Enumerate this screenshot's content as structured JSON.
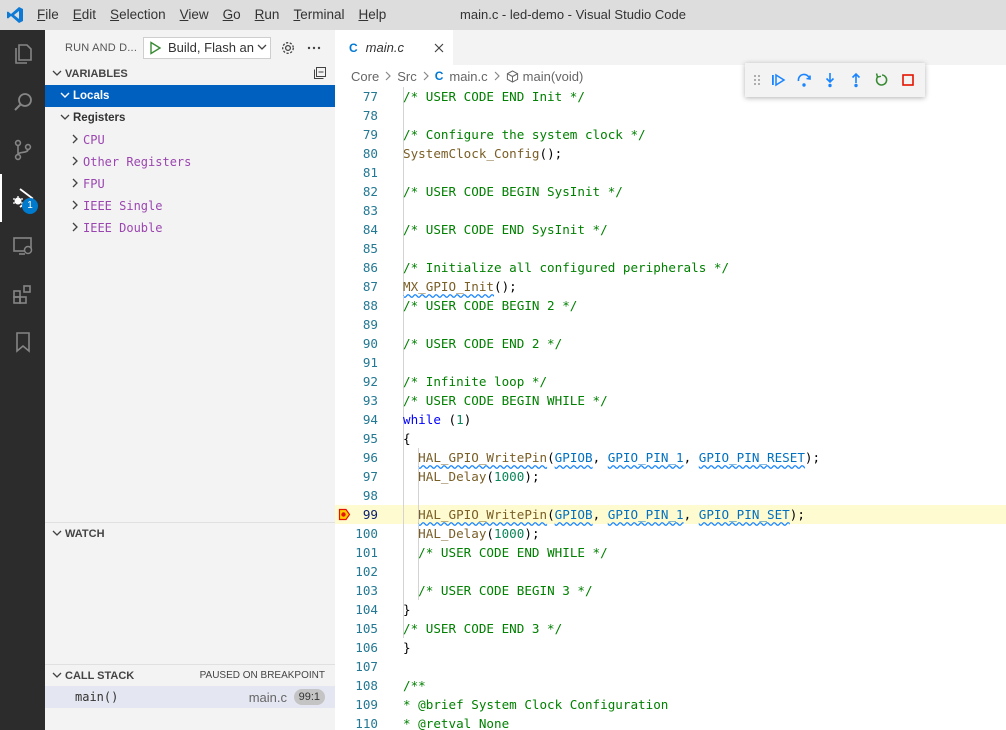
{
  "window": {
    "title": "main.c - led-demo - Visual Studio Code",
    "menu": [
      {
        "u": "F",
        "rest": "ile"
      },
      {
        "u": "E",
        "rest": "dit"
      },
      {
        "u": "S",
        "rest": "election"
      },
      {
        "u": "V",
        "rest": "iew"
      },
      {
        "u": "G",
        "rest": "o"
      },
      {
        "u": "R",
        "rest": "un"
      },
      {
        "u": "T",
        "rest": "erminal"
      },
      {
        "u": "H",
        "rest": "elp"
      }
    ]
  },
  "activity_bar": {
    "items": [
      "files-icon",
      "search-icon",
      "source-control-icon",
      "run-debug-icon",
      "remote-explorer-icon",
      "extensions-icon",
      "bookmarks-icon"
    ],
    "debug_badge": "1"
  },
  "sidebar": {
    "title": "RUN AND D...",
    "launch_config": "Build, Flash and Debug",
    "variables": {
      "header": "VARIABLES",
      "locals": "Locals",
      "registers": "Registers",
      "register_groups": [
        "CPU",
        "Other Registers",
        "FPU",
        "IEEE Single",
        "IEEE Double"
      ]
    },
    "watch": {
      "header": "WATCH"
    },
    "call_stack": {
      "header": "CALL STACK",
      "status": "PAUSED ON BREAKPOINT",
      "frame_name": "main()",
      "frame_file": "main.c",
      "frame_pos": "99:1"
    }
  },
  "editor": {
    "tab_lang": "C",
    "tab_name": "main.c",
    "breadcrumb": [
      "Core",
      "Src",
      "main.c",
      "main(void)"
    ],
    "current_line": 99,
    "lines": [
      {
        "n": "77",
        "t": "  /* USER CODE END Init */"
      },
      {
        "n": "78",
        "t": ""
      },
      {
        "n": "79",
        "t": "  /* Configure the system clock */"
      },
      {
        "n": "80",
        "t": "  SystemClock_Config();"
      },
      {
        "n": "81",
        "t": ""
      },
      {
        "n": "82",
        "t": "  /* USER CODE BEGIN SysInit */"
      },
      {
        "n": "83",
        "t": ""
      },
      {
        "n": "84",
        "t": "  /* USER CODE END SysInit */"
      },
      {
        "n": "85",
        "t": ""
      },
      {
        "n": "86",
        "t": "  /* Initialize all configured peripherals */"
      },
      {
        "n": "87",
        "t": "  MX_GPIO_Init();"
      },
      {
        "n": "88",
        "t": "  /* USER CODE BEGIN 2 */"
      },
      {
        "n": "89",
        "t": ""
      },
      {
        "n": "90",
        "t": "  /* USER CODE END 2 */"
      },
      {
        "n": "91",
        "t": ""
      },
      {
        "n": "92",
        "t": "  /* Infinite loop */"
      },
      {
        "n": "93",
        "t": "  /* USER CODE BEGIN WHILE */"
      },
      {
        "n": "94",
        "t": "  while (1)"
      },
      {
        "n": "95",
        "t": "  {"
      },
      {
        "n": "96",
        "t": "    HAL_GPIO_WritePin(GPIOB, GPIO_PIN_1, GPIO_PIN_RESET);"
      },
      {
        "n": "97",
        "t": "    HAL_Delay(1000);"
      },
      {
        "n": "98",
        "t": ""
      },
      {
        "n": "99",
        "t": "    HAL_GPIO_WritePin(GPIOB, GPIO_PIN_1, GPIO_PIN_SET);"
      },
      {
        "n": "100",
        "t": "    HAL_Delay(1000);"
      },
      {
        "n": "101",
        "t": "    /* USER CODE END WHILE */"
      },
      {
        "n": "102",
        "t": ""
      },
      {
        "n": "103",
        "t": "    /* USER CODE BEGIN 3 */"
      },
      {
        "n": "104",
        "t": "  }"
      },
      {
        "n": "105",
        "t": "  /* USER CODE END 3 */"
      },
      {
        "n": "106",
        "t": "}"
      },
      {
        "n": "107",
        "t": ""
      },
      {
        "n": "108",
        "t": "/**"
      },
      {
        "n": "109",
        "t": "  * @brief System Clock Configuration"
      },
      {
        "n": "110",
        "t": "  * @retval None"
      }
    ]
  },
  "colors": {
    "selection": "#0060c0",
    "accent": "#007acc",
    "current_line": "#fffbd0",
    "comment": "#008000",
    "keyword": "#0000ff"
  }
}
